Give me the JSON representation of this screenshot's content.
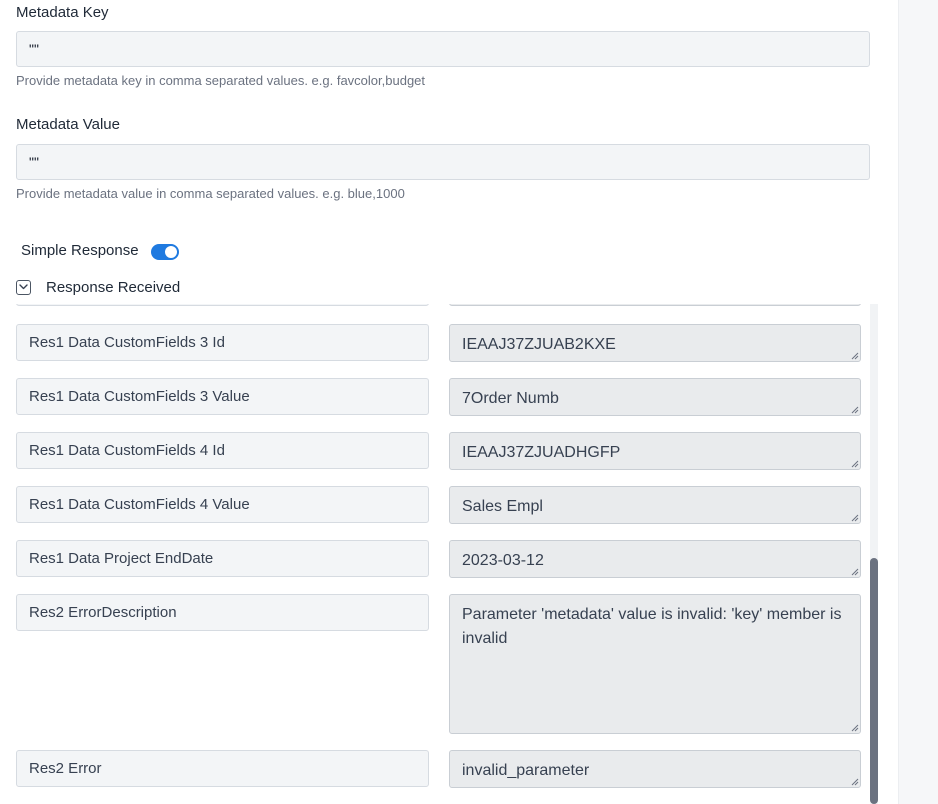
{
  "metadata_key": {
    "label": "Metadata Key",
    "value": "\"\"",
    "help": "Provide metadata key in comma separated values. e.g. favcolor,budget"
  },
  "metadata_value": {
    "label": "Metadata Value",
    "value": "\"\"",
    "help": "Provide metadata value in comma separated values. e.g. blue,1000"
  },
  "simple_response": {
    "label": "Simple Response",
    "enabled": true
  },
  "response_received": {
    "label": "Response Received",
    "rows": [
      {
        "key": "Res1 Data CustomFields 3 Id",
        "value": "IEAAJ37ZJUAB2KXE"
      },
      {
        "key": "Res1 Data CustomFields 3 Value",
        "value": "7Order Numb"
      },
      {
        "key": "Res1 Data CustomFields 4 Id",
        "value": "IEAAJ37ZJUADHGFP"
      },
      {
        "key": "Res1 Data CustomFields 4 Value",
        "value": "Sales Empl"
      },
      {
        "key": "Res1 Data Project EndDate",
        "value": "2023-03-12"
      },
      {
        "key": "Res2 ErrorDescription",
        "value": "Parameter 'metadata' value is invalid: 'key' member is invalid"
      },
      {
        "key": "Res2 Error",
        "value": "invalid_parameter"
      }
    ]
  },
  "colors": {
    "accent": "#1f7ae0",
    "input_bg": "#f3f5f7",
    "value_bg": "#e9ebed",
    "scroll_thumb": "#6b7280"
  }
}
